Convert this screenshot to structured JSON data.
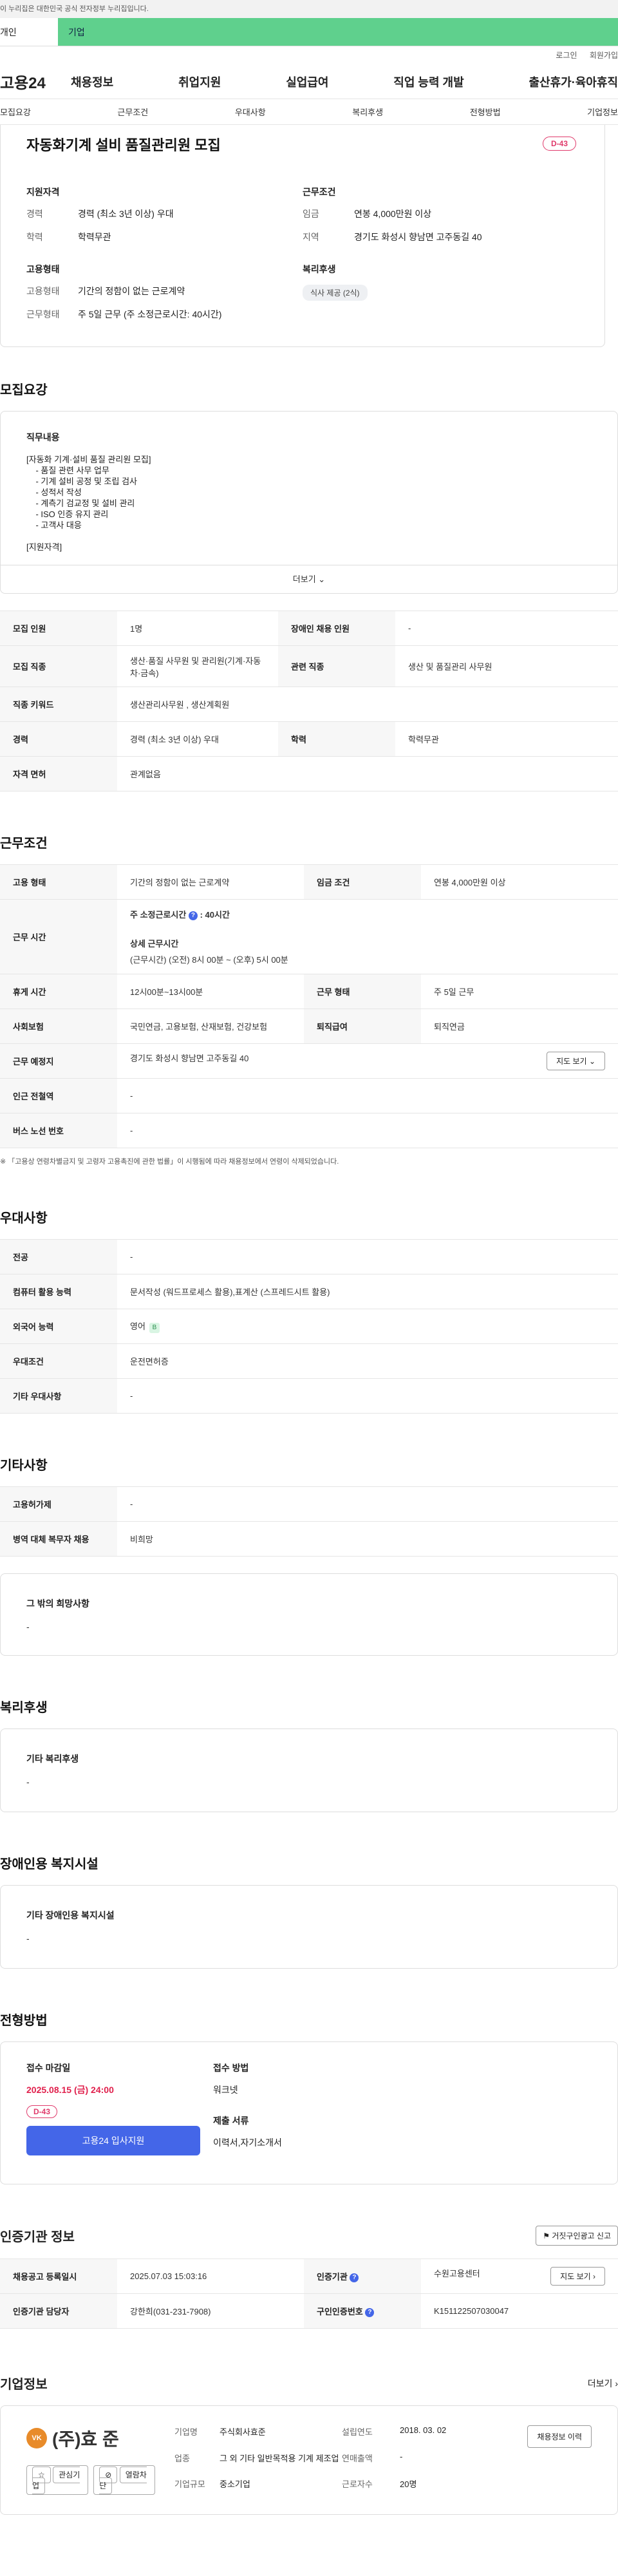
{
  "gov_bar": {
    "text": "이 누리집은 대한민국 공식 전자정부 누리집입니다."
  },
  "service_tabs": {
    "personal": "개인",
    "company": "기업"
  },
  "util": {
    "login": "로그인",
    "signup": "회원가입"
  },
  "gnb": {
    "logo": "고용24",
    "menu": [
      "채용정보",
      "취업지원",
      "실업급여",
      "직업 능력 개발",
      "출산휴가·육아휴직"
    ]
  },
  "subnav": [
    "모집요강",
    "근무조건",
    "우대사항",
    "복리후생",
    "전형방법",
    "기업정보"
  ],
  "summary": {
    "title": "자동화기계 설비 품질관리원 모집",
    "dday": "D-43",
    "qual_h": "지원자격",
    "career_k": "경력",
    "career_v": "경력 (최소 3년 이상) 우대",
    "edu_k": "학력",
    "edu_v": "학력무관",
    "emp_h": "고용형태",
    "emptype_k": "고용형태",
    "emptype_v": "기간의 정함이 없는 근로계약",
    "worktype_k": "근무형태",
    "worktype_v": "주 5일 근무 (주 소정근로시간: 40시간)",
    "cond_h": "근무조건",
    "wage_k": "임금",
    "wage_v": "연봉 4,000만원 이상",
    "region_k": "지역",
    "region_v": "경기도 화성시 향남면 고주동길 40",
    "welfare_h": "복리후생",
    "welfare_chip": "식사 제공 (2식)"
  },
  "recruit": {
    "heading": "모집요강",
    "duty_h": "직무내용",
    "duty_body": "[자동화 기계·설비 품질 관리원 모집]\n    - 품질 관련 사무 업무\n    - 기계 설비 공정 및 조립 검사\n    - 성적서 작성\n    - 계측기 검교정 및 설비 관리\n    - ISO 인증 유지 관리\n    - 고객사 대응\n\n[지원자격]",
    "more": "더보기",
    "headcount_k": "모집 인원",
    "headcount_v": "1명",
    "disabled_k": "장애인 채용 인원",
    "disabled_v": "-",
    "job_k": "모집 직종",
    "job_v": "생산·품질 사무원 및 관리원(기계·자동차·금속)",
    "related_k": "관련 직종",
    "related_v": "생산 및 품질관리 사무원",
    "keyword_k": "직종 키워드",
    "keyword_v": "생산관리사무원 , 생산계획원",
    "career_k": "경력",
    "career_v": "경력 (최소 3년 이상) 우대",
    "edu_k": "학력",
    "edu_v": "학력무관",
    "license_k": "자격 면허",
    "license_v": "관계없음"
  },
  "work": {
    "heading": "근무조건",
    "emptype_k": "고용 형태",
    "emptype_v": "기간의 정함이 없는 근로계약",
    "wagecond_k": "임금 조건",
    "wagecond_v": "연봉 4,000만원 이상",
    "hours_k": "근무 시간",
    "hours_line1": "주 소정근로시간",
    "hours_line1_v": ": 40시간",
    "hours_line2": "상세 근무시간",
    "hours_line3": "(근무시간) (오전) 8시 00분 ~ (오후) 5시 00분",
    "break_k": "휴게 시간",
    "break_v": "12시00분~13시00분",
    "worktype_k": "근무 형태",
    "worktype_v": "주 5일 근무",
    "insurance_k": "사회보험",
    "insurance_v": "국민연금, 고용보험, 산재보험, 건강보험",
    "retire_k": "퇴직급여",
    "retire_v": "퇴직연금",
    "place_k": "근무 예정지",
    "place_v": "경기도 화성시 향남면 고주동길 40",
    "map_btn": "지도 보기",
    "station_k": "인근 전철역",
    "station_v": "-",
    "bus_k": "버스 노선 번호",
    "bus_v": "-",
    "note": "※ 「고용상 연령차별금지 및 고령자 고용촉진에 관한 법률」이 시행됨에 따라 채용정보에서 연령이 삭제되었습니다."
  },
  "pref": {
    "heading": "우대사항",
    "major_k": "전공",
    "major_v": "-",
    "computer_k": "컴퓨터 활용 능력",
    "computer_v": "문서작성 (워드프로세스 활용),표계산 (스프레드시트 활용)",
    "lang_k": "외국어 능력",
    "lang_v": "영어",
    "lang_badge": "B",
    "cond_k": "우대조건",
    "cond_v": "운전면허증",
    "etc_k": "기타 우대사항",
    "etc_v": "-"
  },
  "etc": {
    "heading": "기타사항",
    "emp_support_k": "고용허가제",
    "emp_support_v": "-",
    "military_k": "병역 대체 복무자 채용",
    "military_v": "비희망",
    "wish_h": "그 밖의 희망사항",
    "wish_v": "-"
  },
  "welfare": {
    "heading": "복리후생",
    "h": "기타 복리후생",
    "v": "-"
  },
  "facility": {
    "heading": "장애인용 복지시설",
    "h": "기타 장애인용 복지시설",
    "v": "-"
  },
  "process": {
    "heading": "전형방법",
    "deadline_h": "접수 마감일",
    "deadline_v": "2025.08.15 (금) 24:00",
    "dday": "D-43",
    "apply_btn": "고용24 입사지원",
    "method_h": "접수 방법",
    "method_v": "워크넷",
    "docs_h": "제출 서류",
    "docs_v": "이력서,자기소개서"
  },
  "cert": {
    "heading": "인증기관 정보",
    "report_btn": "거짓구인광고 신고",
    "date_k": "채용공고 등록일시",
    "date_v": "2025.07.03 15:03:16",
    "org_k": "인증기관",
    "org_v": "수원고용센터",
    "map_btn": "지도 보기",
    "manager_k": "인증기관 담당자",
    "manager_v": "강한희(031-231-7908)",
    "id_k": "구인인증번호",
    "id_v": "K151122507030047"
  },
  "company": {
    "heading": "기업정보",
    "more": "더보기",
    "logo_mark": "VK",
    "name": "(주)효 준",
    "fav_btn": "관심기업",
    "block_btn": "열람차단",
    "name_k": "기업명",
    "name_v": "주식회사효준",
    "founded_k": "설립연도",
    "founded_v": "2018. 03. 02",
    "industry_k": "업종",
    "industry_v": "그 외 기타 일반목적용 기계 제조업",
    "sales_k": "연매출액",
    "sales_v": "-",
    "employees_k": "근로자수",
    "employees_v": "20명",
    "size_k": "기업규모",
    "size_v": "중소기업",
    "jobs_btn": "채용정보 이력"
  }
}
